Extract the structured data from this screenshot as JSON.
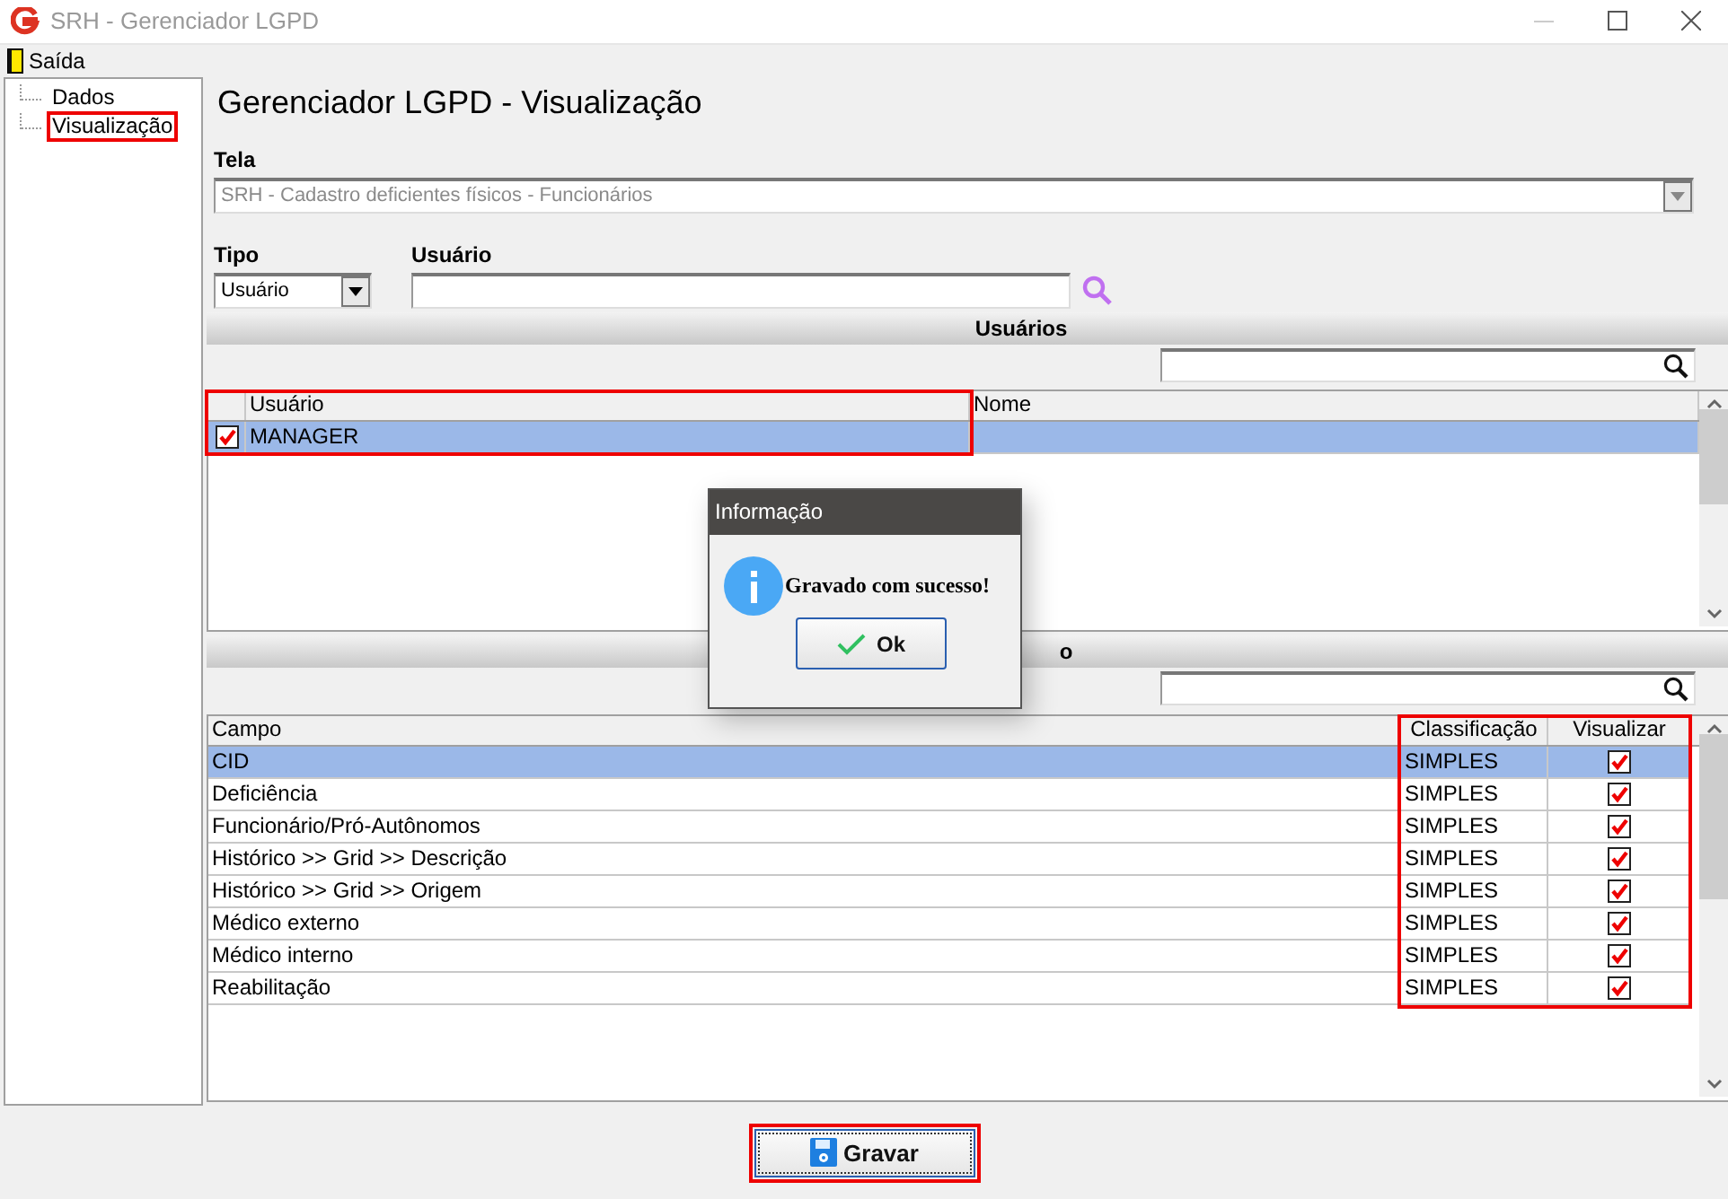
{
  "window": {
    "title": "SRH - Gerenciador LGPD"
  },
  "menu": [
    {
      "label": "Saída"
    }
  ],
  "tree": [
    {
      "label": "Dados",
      "annotated": false
    },
    {
      "label": "Visualização",
      "annotated": true
    }
  ],
  "heading": "Gerenciador LGPD - Visualização",
  "form": {
    "tela": {
      "label": "Tela",
      "value": "SRH - Cadastro deficientes físicos - Funcionários",
      "disabled": true
    },
    "tipo": {
      "label": "Tipo",
      "value": "Usuário"
    },
    "usuario": {
      "label": "Usuário"
    }
  },
  "users_section": {
    "title": "Usuários",
    "check_annotated": true,
    "columns": [
      {
        "label": "Usuário",
        "annotated": true
      },
      {
        "label": "Nome",
        "annotated": false
      }
    ],
    "rows": [
      {
        "checked": true,
        "usuario": "MANAGER",
        "selected": true
      }
    ]
  },
  "fields_section": {
    "title": "o",
    "columns": [
      {
        "label": "Campo",
        "annotated": false
      },
      {
        "label": "Classificação",
        "annotated": true
      },
      {
        "label": "Visualizar",
        "annotated": true
      }
    ],
    "rows": [
      {
        "campo": "CID",
        "classificacao": "SIMPLES",
        "visualizar": true,
        "selected": true
      },
      {
        "campo": "Deficiência",
        "classificacao": "SIMPLES",
        "visualizar": true,
        "selected": false
      },
      {
        "campo": "Funcionário/Pró-Autônomos",
        "classificacao": "SIMPLES",
        "visualizar": true,
        "selected": false
      },
      {
        "campo": "Histórico >> Grid >> Descrição",
        "classificacao": "SIMPLES",
        "visualizar": true,
        "selected": false
      },
      {
        "campo": "Histórico >> Grid >> Origem",
        "classificacao": "SIMPLES",
        "visualizar": true,
        "selected": false
      },
      {
        "campo": "Médico externo",
        "classificacao": "SIMPLES",
        "visualizar": true,
        "selected": false
      },
      {
        "campo": "Médico interno",
        "classificacao": "SIMPLES",
        "visualizar": true,
        "selected": false
      },
      {
        "campo": "Reabilitação",
        "classificacao": "SIMPLES",
        "visualizar": true,
        "selected": false
      }
    ]
  },
  "save_button": {
    "label": "Gravar",
    "annotated": true
  },
  "dialog": {
    "title": "Informação",
    "message": "Gravado com sucesso!",
    "button": "Ok"
  }
}
